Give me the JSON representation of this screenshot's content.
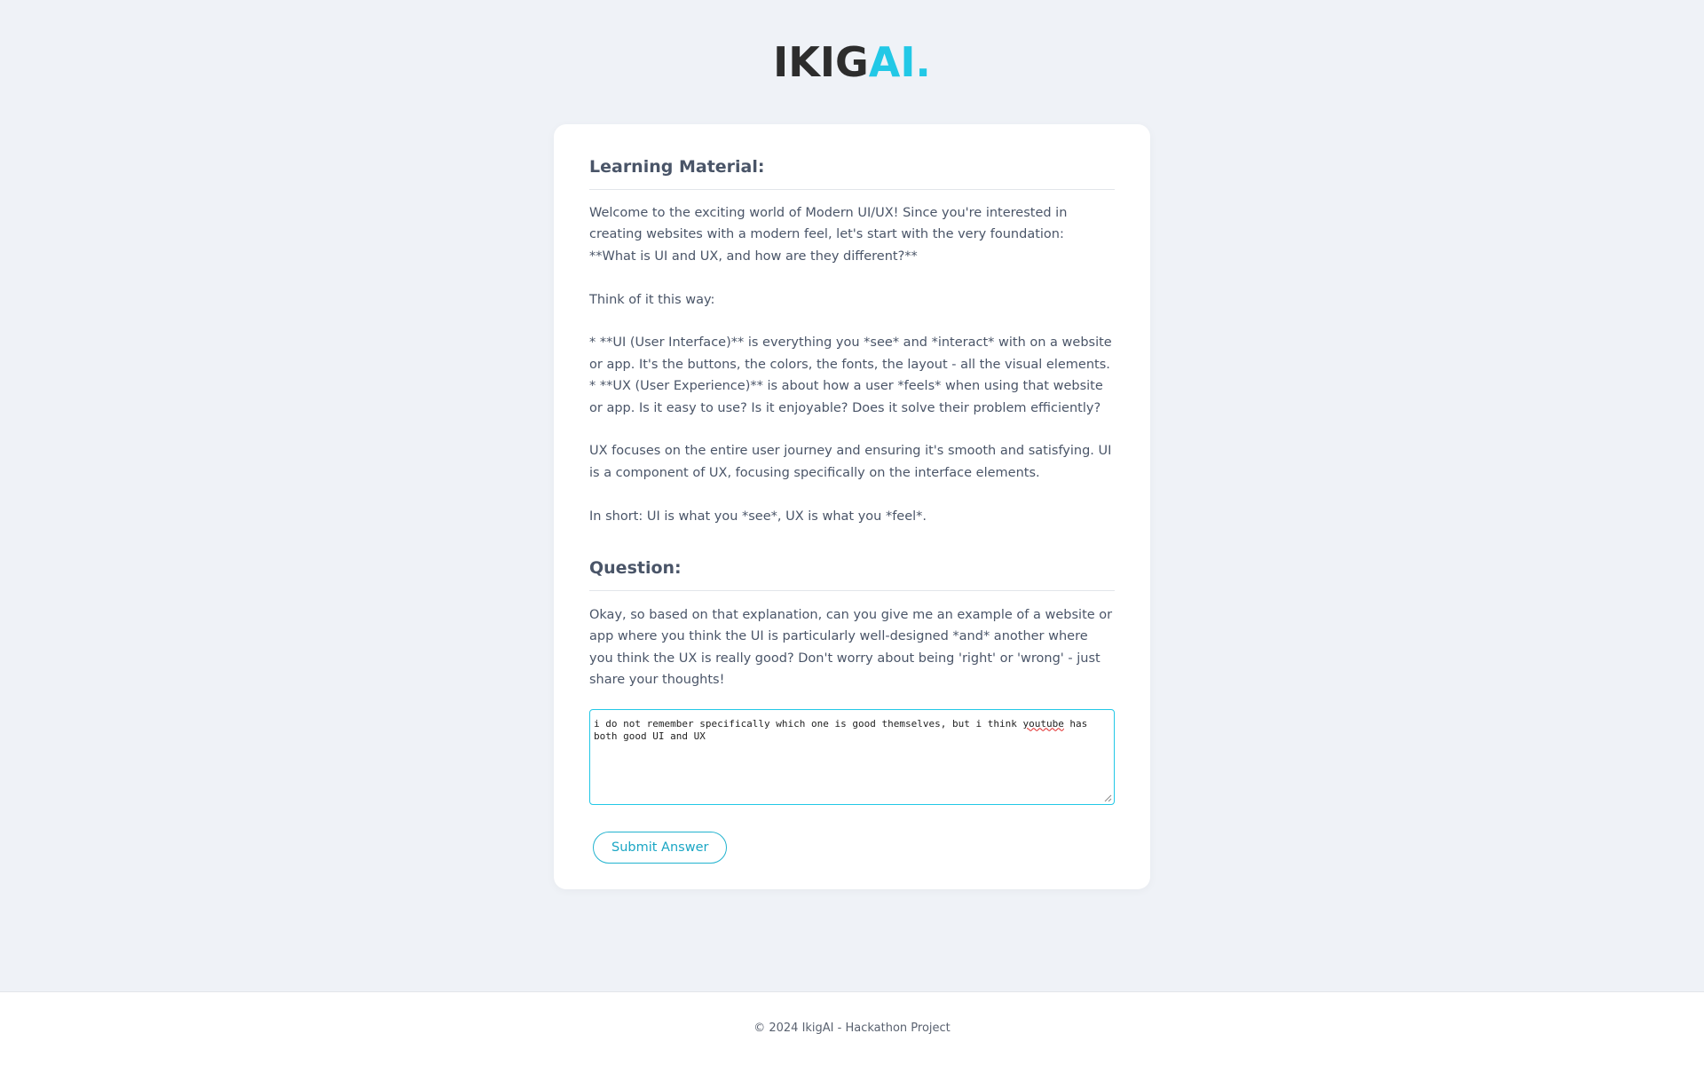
{
  "header": {
    "logo_main": "IKIG",
    "logo_accent": "AI."
  },
  "learning": {
    "title": "Learning Material:",
    "paragraphs": [
      "Welcome to the exciting world of Modern UI/UX! Since you're interested in creating websites with a modern feel, let's start with the very foundation: **What is UI and UX, and how are they different?**",
      "Think of it this way:",
      "*   **UI (User Interface)** is everything you *see* and *interact* with on a website or app. It's the buttons, the colors, the fonts, the layout - all the visual elements.",
      "*   **UX (User Experience)** is about how a user *feels* when using that website or app. Is it easy to use? Is it enjoyable? Does it solve their problem efficiently?",
      "UX focuses on the entire user journey and ensuring it's smooth and satisfying. UI is a component of UX, focusing specifically on the interface elements.",
      "In short: UI is what you *see*, UX is what you *feel*."
    ]
  },
  "question": {
    "title": "Question:",
    "text": "Okay, so based on that explanation, can you give me an example of a website or app where you think the UI is particularly well-designed *and* another where you think the UX is really good? Don't worry about being 'right' or 'wrong' - just share your thoughts!"
  },
  "answer": {
    "before": "i do not remember specifically which one is good themselves, but i think ",
    "misspelled": "youtube",
    "after": " has both good UI and UX"
  },
  "submit_label": "Submit Answer",
  "footer": {
    "text": "© 2024 IkigAI - Hackathon Project"
  },
  "colors": {
    "accent": "#22c8e6",
    "background": "#eff2f7"
  }
}
